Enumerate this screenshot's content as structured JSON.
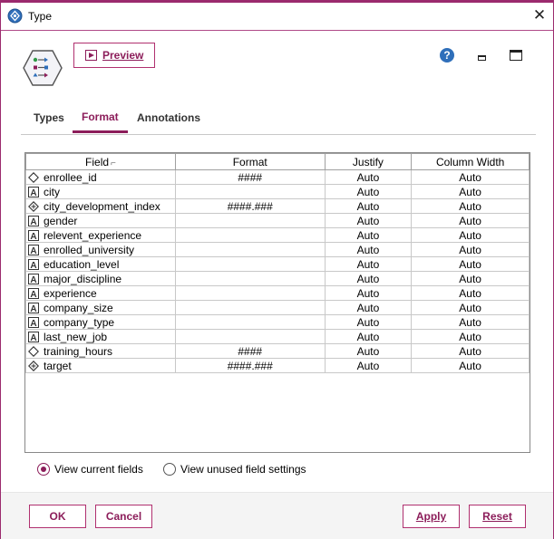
{
  "window": {
    "title": "Type",
    "icon": "type-node-icon"
  },
  "toolbar": {
    "preview_label": "Preview",
    "help_label": "?"
  },
  "tabs": [
    {
      "label": "Types",
      "active": false
    },
    {
      "label": "Format",
      "active": true
    },
    {
      "label": "Annotations",
      "active": false
    }
  ],
  "grid": {
    "columns": [
      "Field",
      "Format",
      "Justify",
      "Column Width"
    ],
    "rows": [
      {
        "field": "enrollee_id",
        "type_icon": "continuous-diamond-icon",
        "format": "####",
        "justify": "Auto",
        "width": "Auto"
      },
      {
        "field": "city",
        "type_icon": "string-a-icon",
        "format": "",
        "justify": "Auto",
        "width": "Auto"
      },
      {
        "field": "city_development_index",
        "type_icon": "real-diamond-icon",
        "format": "####.###",
        "justify": "Auto",
        "width": "Auto"
      },
      {
        "field": "gender",
        "type_icon": "string-a-icon",
        "format": "",
        "justify": "Auto",
        "width": "Auto"
      },
      {
        "field": "relevent_experience",
        "type_icon": "string-a-icon",
        "format": "",
        "justify": "Auto",
        "width": "Auto"
      },
      {
        "field": "enrolled_university",
        "type_icon": "string-a-icon",
        "format": "",
        "justify": "Auto",
        "width": "Auto"
      },
      {
        "field": "education_level",
        "type_icon": "string-a-icon",
        "format": "",
        "justify": "Auto",
        "width": "Auto"
      },
      {
        "field": "major_discipline",
        "type_icon": "string-a-icon",
        "format": "",
        "justify": "Auto",
        "width": "Auto"
      },
      {
        "field": "experience",
        "type_icon": "string-a-icon",
        "format": "",
        "justify": "Auto",
        "width": "Auto"
      },
      {
        "field": "company_size",
        "type_icon": "string-a-icon",
        "format": "",
        "justify": "Auto",
        "width": "Auto"
      },
      {
        "field": "company_type",
        "type_icon": "string-a-icon",
        "format": "",
        "justify": "Auto",
        "width": "Auto"
      },
      {
        "field": "last_new_job",
        "type_icon": "string-a-icon",
        "format": "",
        "justify": "Auto",
        "width": "Auto"
      },
      {
        "field": "training_hours",
        "type_icon": "continuous-diamond-icon",
        "format": "####",
        "justify": "Auto",
        "width": "Auto"
      },
      {
        "field": "target",
        "type_icon": "real-diamond-icon",
        "format": "####.###",
        "justify": "Auto",
        "width": "Auto"
      }
    ]
  },
  "view_options": [
    {
      "label": "View current fields",
      "selected": true
    },
    {
      "label": "View unused field settings",
      "selected": false
    }
  ],
  "buttons": {
    "ok": "OK",
    "cancel": "Cancel",
    "apply": "Apply",
    "reset": "Reset"
  },
  "colors": {
    "accent": "#8c1d5a",
    "help_blue": "#2f6fba"
  }
}
